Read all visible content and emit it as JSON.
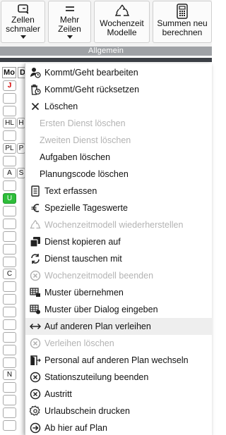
{
  "toolbar": {
    "buttons": [
      {
        "label_line1": "Zellen",
        "label_line2": "schmaler",
        "has_caret": true,
        "icon": "narrow-cells-icon"
      },
      {
        "label_line1": "Mehr",
        "label_line2": "Zeilen",
        "has_caret": true,
        "icon": "more-rows-icon"
      },
      {
        "label_line1": "Wochenzeit",
        "label_line2": "Modelle",
        "has_caret": false,
        "icon": "recycle-icon"
      },
      {
        "label_line1": "Summen neu",
        "label_line2": "berechnen",
        "has_caret": false,
        "icon": "calculator-icon"
      }
    ],
    "group_label": "Allgemein"
  },
  "grid": {
    "headers": [
      "Mo",
      "D"
    ],
    "cells": [
      "J",
      "HL",
      "H",
      "PL",
      "P",
      "A",
      "S",
      "U",
      "C",
      "N"
    ]
  },
  "menu": {
    "items": [
      {
        "label": "Kommt/Geht bearbeiten",
        "icon": "user-clock-icon",
        "enabled": true
      },
      {
        "label": "Kommt/Geht rücksetzen",
        "icon": "trash-clock-icon",
        "enabled": true
      },
      {
        "label": "Löschen",
        "icon": "close-icon",
        "enabled": true
      },
      {
        "label": "Ersten Dienst löschen",
        "icon": "",
        "enabled": false
      },
      {
        "label": "Zweiten Dienst löschen",
        "icon": "",
        "enabled": false
      },
      {
        "label": "Aufgaben löschen",
        "icon": "",
        "enabled": true
      },
      {
        "label": "Planungscode löschen",
        "icon": "",
        "enabled": true
      },
      {
        "label": "Text erfassen",
        "icon": "document-icon",
        "enabled": true
      },
      {
        "label": "Spezielle Tageswerte",
        "icon": "euro-icon",
        "enabled": true
      },
      {
        "label": "Wochenzeitmodell wiederherstellen",
        "icon": "recycle-icon",
        "enabled": false
      },
      {
        "label": "Dienst kopieren auf",
        "icon": "copy-icon",
        "enabled": true
      },
      {
        "label": "Dienst tauschen mit",
        "icon": "swap-icon",
        "enabled": true
      },
      {
        "label": "Wochenzeitmodell beenden",
        "icon": "circle-x-icon",
        "enabled": false
      },
      {
        "label": "Muster übernehmen",
        "icon": "pattern-icon",
        "enabled": true
      },
      {
        "label": "Muster über Dialog eingeben",
        "icon": "pattern-dialog-icon",
        "enabled": true
      },
      {
        "label": "Auf anderen Plan verleihen",
        "icon": "arrows-horizontal-icon",
        "enabled": true
      },
      {
        "label": "Verleihen löschen",
        "icon": "circle-x-icon",
        "enabled": false
      },
      {
        "label": "Personal auf anderen Plan wechseln",
        "icon": "door-exit-icon",
        "enabled": true
      },
      {
        "label": "Stationszuteilung beenden",
        "icon": "circle-x-icon",
        "enabled": true
      },
      {
        "label": "Austritt",
        "icon": "circle-x-icon",
        "enabled": true
      },
      {
        "label": "Urlaubschein drucken",
        "icon": "gear-badge-icon",
        "enabled": true
      },
      {
        "label": "Ab hier auf Plan",
        "icon": "circle-arrow-right-icon",
        "enabled": true
      }
    ]
  }
}
